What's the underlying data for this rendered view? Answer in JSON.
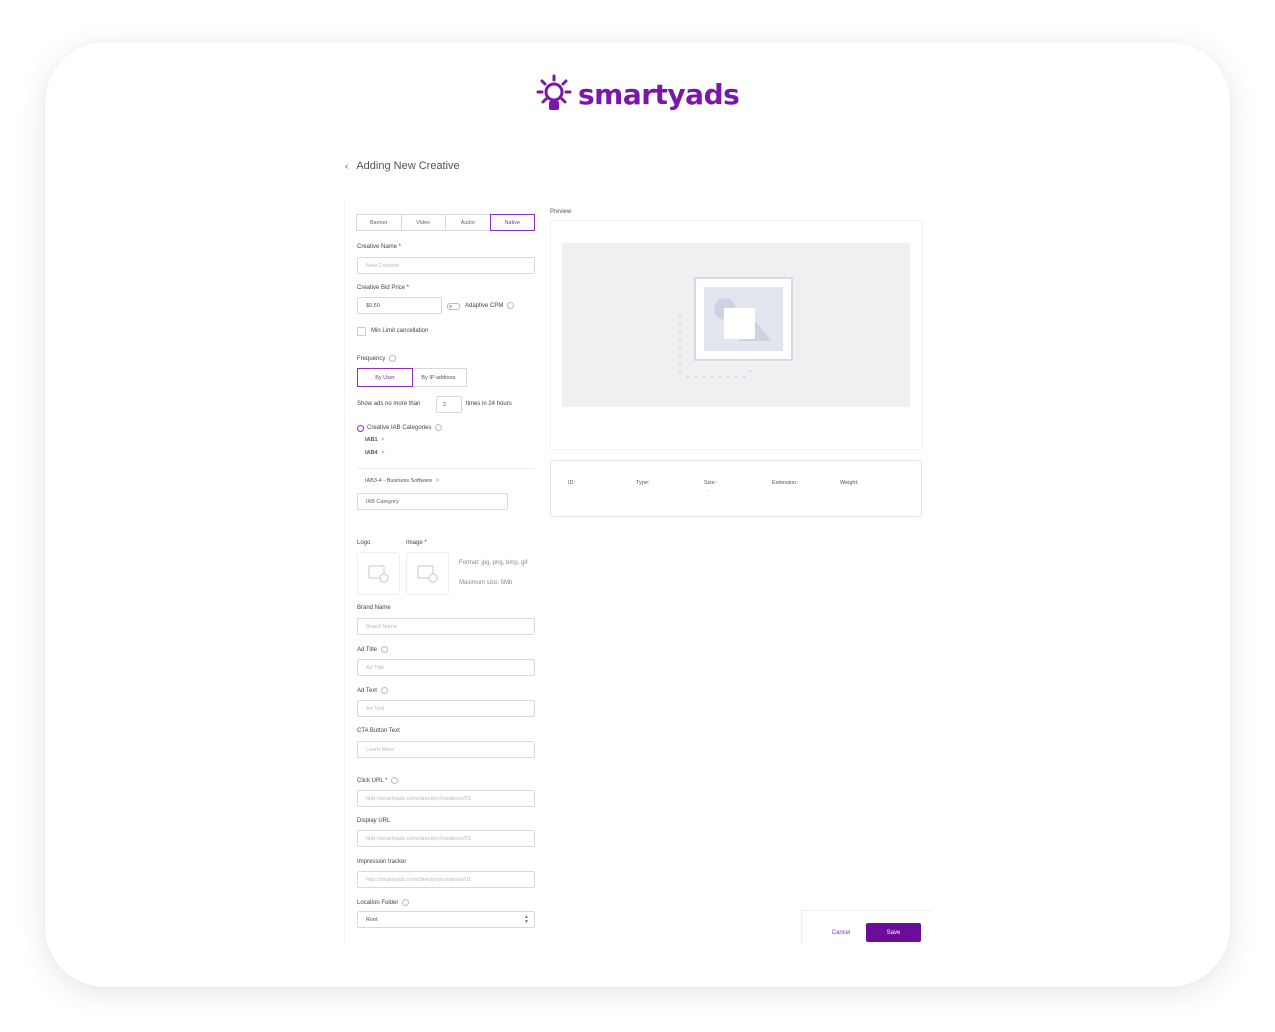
{
  "brand": {
    "name": "smartyads",
    "color": "#7a16a8"
  },
  "page": {
    "title": "Adding New Creative",
    "back_icon": "chevron-left-icon"
  },
  "tabs": [
    "Banner",
    "Video",
    "Audio",
    "Native"
  ],
  "active_tab": "Native",
  "form": {
    "creative_name": {
      "label": "Creative Name *",
      "placeholder": "New Creative"
    },
    "bid_price": {
      "label": "Creative Bid Price *",
      "value": "$0.50",
      "adaptive_cpm_label": "Adaptive CPM"
    },
    "min_limit_label": "Min Limit cancellation",
    "frequency": {
      "label": "Frequency",
      "options": [
        "By User",
        "By IP address"
      ],
      "selected": "By User",
      "prefix": "Show ads no more than",
      "value": "2",
      "suffix": "times in 24 hours"
    },
    "iab": {
      "label": "Creative IAB Categories",
      "chips": [
        "IAB1",
        "IAB4"
      ],
      "sub_chip": "IAB3-4 - Business Software",
      "placeholder": "IAB Category"
    },
    "media": {
      "logo_label": "Logo",
      "image_label": "Image *",
      "format_text": "Format: jpg, png, bmp, gif",
      "max_size_text": "Maximum size: 5Mb"
    },
    "brand_name": {
      "label": "Brand Name",
      "placeholder": "Brand Name"
    },
    "ad_title": {
      "label": "Ad Title",
      "placeholder": "Ad Title"
    },
    "ad_text": {
      "label": "Ad Text",
      "placeholder": "Ad Text"
    },
    "cta": {
      "label": "CTA Button Text",
      "placeholder": "Learn More"
    },
    "click_url": {
      "label": "Click URL *",
      "placeholder": "http://smartyads.com/directory/creatives/01"
    },
    "display_url": {
      "label": "Display URL",
      "placeholder": "http://smartyads.com/directory/creatives/01"
    },
    "impression_tracker": {
      "label": "Impression tracker",
      "placeholder": "http://smartyads.com/directory/creatives/01"
    },
    "location_folder": {
      "label": "Location Folder",
      "value": "Root"
    }
  },
  "preview": {
    "label": "Preview",
    "columns": [
      "ID:",
      "Type:",
      "Size:",
      "Extension:",
      "Weight:"
    ],
    "size_value": "-"
  },
  "actions": {
    "cancel": "Cancel",
    "save": "Save",
    "save_color": "#6a0e99"
  }
}
